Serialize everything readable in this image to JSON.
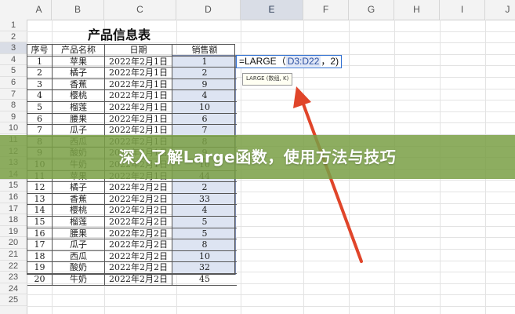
{
  "spreadsheet": {
    "columns": [
      "A",
      "B",
      "C",
      "D",
      "E",
      "F",
      "G",
      "H",
      "I",
      "J"
    ],
    "selected_column": "E",
    "rows": [
      "1",
      "2",
      "3",
      "4",
      "5",
      "6",
      "7",
      "8",
      "9",
      "10",
      "11",
      "12",
      "13",
      "14",
      "15",
      "16",
      "17",
      "18",
      "19",
      "20",
      "21",
      "22",
      "23",
      "24",
      "25"
    ],
    "selected_row": "3",
    "title": "产品信息表",
    "headers": [
      "序号",
      "产品名称",
      "日期",
      "销售额"
    ],
    "data": [
      [
        "1",
        "苹果",
        "2022年2月1日",
        "1"
      ],
      [
        "2",
        "橘子",
        "2022年2月1日",
        "2"
      ],
      [
        "3",
        "香蕉",
        "2022年2月1日",
        "9"
      ],
      [
        "4",
        "樱桃",
        "2022年2月1日",
        "4"
      ],
      [
        "5",
        "榴莲",
        "2022年2月1日",
        "10"
      ],
      [
        "6",
        "腰果",
        "2022年2月1日",
        "6"
      ],
      [
        "7",
        "瓜子",
        "2022年2月1日",
        "7"
      ],
      [
        "8",
        "西瓜",
        "2022年2月1日",
        "8"
      ],
      [
        "9",
        "酸奶",
        "2022年2月1日",
        "9"
      ],
      [
        "10",
        "牛奶",
        "2022年2月1日",
        "10"
      ],
      [
        "11",
        "苹果",
        "2022年2月1日",
        "44"
      ],
      [
        "12",
        "橘子",
        "2022年2月2日",
        "2"
      ],
      [
        "13",
        "香蕉",
        "2022年2月2日",
        "33"
      ],
      [
        "14",
        "樱桃",
        "2022年2月2日",
        "4"
      ],
      [
        "15",
        "榴莲",
        "2022年2月2日",
        "5"
      ],
      [
        "16",
        "腰果",
        "2022年2月2日",
        "5"
      ],
      [
        "17",
        "瓜子",
        "2022年2月2日",
        "8"
      ],
      [
        "18",
        "西瓜",
        "2022年2月2日",
        "10"
      ],
      [
        "19",
        "酸奶",
        "2022年2月2日",
        "32"
      ],
      [
        "20",
        "牛奶",
        "2022年2月2日",
        "45"
      ]
    ],
    "formula": {
      "prefix": "=LARGE（",
      "range": "D3:D22",
      "suffix": "，2)"
    },
    "tooltip": "LARGE (数组, K)"
  },
  "overlay": {
    "caption": "深入了解Large函数，使用方法与技巧"
  },
  "colors": {
    "arrow": "#e0452a",
    "band": "#7aa046",
    "selection": "#dde4f2"
  }
}
